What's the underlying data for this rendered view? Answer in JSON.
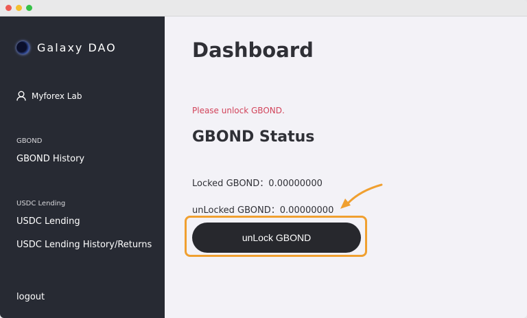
{
  "brand": {
    "name": "Galaxy DAO"
  },
  "user": {
    "name": "Myforex Lab"
  },
  "sidebar": {
    "sections": [
      {
        "label": "GBOND",
        "items": [
          "GBOND History"
        ]
      },
      {
        "label": "USDC Lending",
        "items": [
          "USDC Lending",
          "USDC Lending History/Returns"
        ]
      }
    ],
    "logout": "logout"
  },
  "main": {
    "title": "Dashboard",
    "warning": "Please unlock GBOND.",
    "status_title": "GBOND Status",
    "locked_label": "Locked GBOND：",
    "locked_value": "0.00000000",
    "unlocked_label": "unLocked GBOND：",
    "unlocked_value": "0.00000000",
    "unlock_button": "unLock GBOND"
  },
  "colors": {
    "accent_orange": "#f0a030",
    "warning_red": "#d2435a",
    "sidebar_bg": "#272a33"
  }
}
